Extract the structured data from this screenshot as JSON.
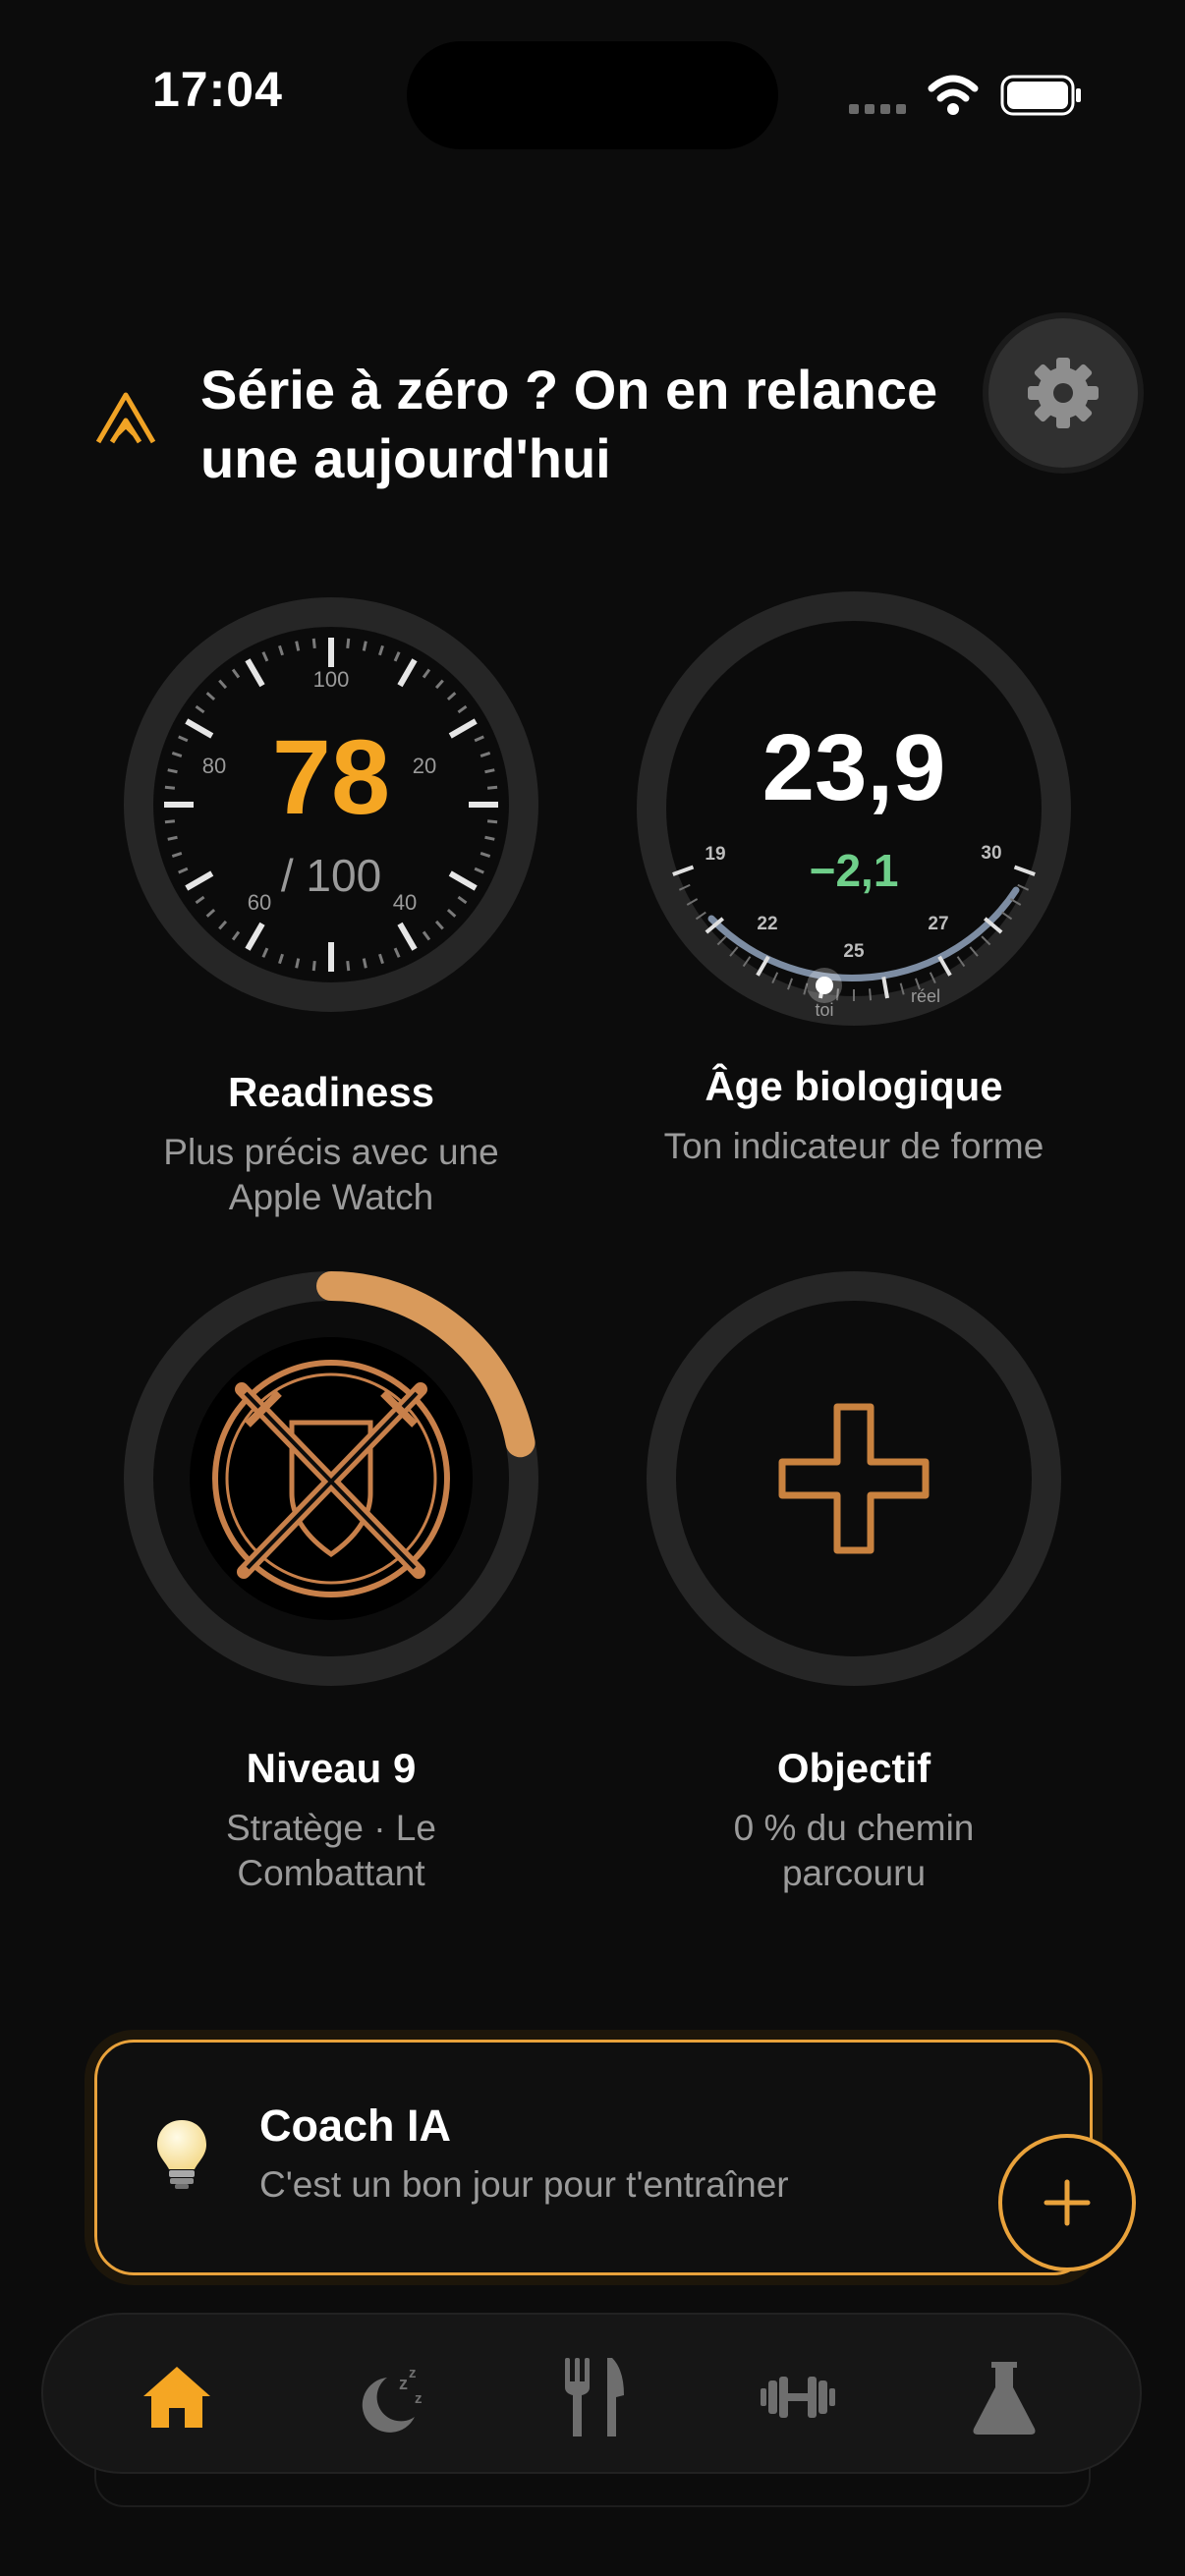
{
  "status_bar": {
    "time": "17:04"
  },
  "header": {
    "title_line1": "Série à zéro ? On en relance",
    "title_line2": "une aujourd'hui"
  },
  "readiness": {
    "value": "78",
    "max_label": "/ 100",
    "dial_labels": [
      "100",
      "20",
      "40",
      "60",
      "80"
    ],
    "title": "Readiness",
    "subtitle_line1": "Plus précis avec une",
    "subtitle_line2": "Apple Watch",
    "accent": "#f5a623"
  },
  "bio_age": {
    "value": "23,9",
    "delta": "−2,1",
    "scale_labels": [
      "19",
      "22",
      "25",
      "27",
      "30"
    ],
    "marker_you": "toi",
    "marker_real": "réel",
    "title": "Âge biologique",
    "subtitle": "Ton indicateur de forme",
    "delta_color": "#6fcf8a"
  },
  "level": {
    "title": "Niveau 9",
    "subtitle_line1": "Stratège · Le",
    "subtitle_line2": "Combattant",
    "progress_fraction": 0.22,
    "ring_color": "#d99a5b"
  },
  "goal": {
    "title": "Objectif",
    "subtitle_line1": "0 % du chemin",
    "subtitle_line2": "parcouru",
    "icon_color": "#c9823f"
  },
  "coach": {
    "title": "Coach IA",
    "message": "C'est un bon jour pour t'entraîner",
    "border_color": "#e9a23b"
  },
  "tabs": [
    {
      "icon": "home-icon",
      "active": true
    },
    {
      "icon": "sleep-icon",
      "active": false
    },
    {
      "icon": "nutrition-icon",
      "active": false
    },
    {
      "icon": "training-icon",
      "active": false
    },
    {
      "icon": "lab-icon",
      "active": false
    }
  ],
  "colors": {
    "accent": "#f5a623",
    "background": "#0c0c0c",
    "muted_text": "#9b9b9b"
  }
}
